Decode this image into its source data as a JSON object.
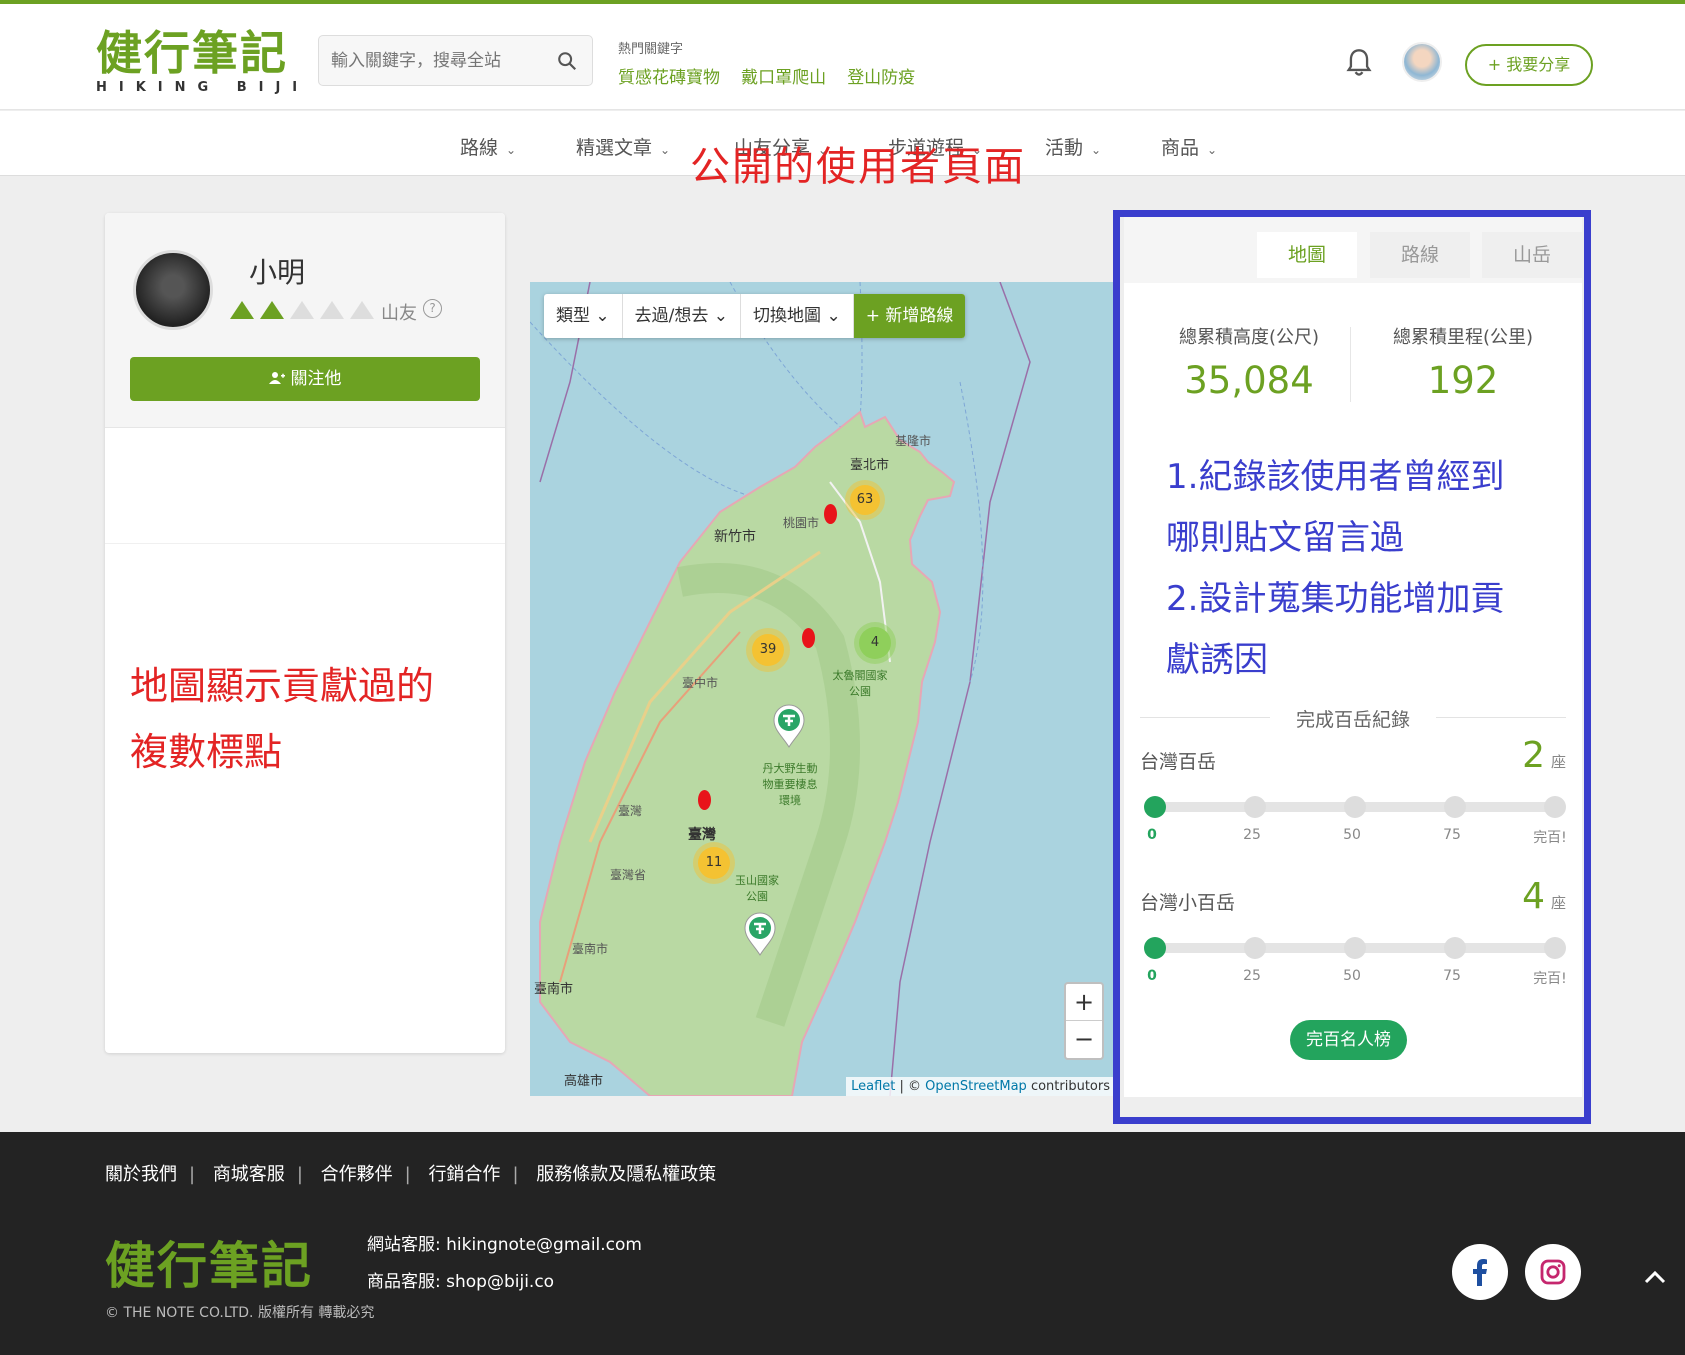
{
  "header": {
    "logo_main": "健行筆記",
    "logo_sub": "HIKING BIJI",
    "search_placeholder": "輸入關鍵字，搜尋全站",
    "hot_title": "熱門關鍵字",
    "hot_keywords": [
      "質感花磚寶物",
      "戴口罩爬山",
      "登山防疫"
    ],
    "share_label": "+ 我要分享"
  },
  "nav": {
    "items": [
      {
        "label": "路線"
      },
      {
        "label": "精選文章"
      },
      {
        "label": "山友分享"
      },
      {
        "label": "步道遊程"
      },
      {
        "label": "活動"
      },
      {
        "label": "商品"
      }
    ]
  },
  "annotations": {
    "title": "公開的使用者頁面",
    "left_line1": "地圖顯示貢獻過的",
    "left_line2": "複數標點",
    "right_line1": "1.紀錄該使用者曾經到",
    "right_line2": "哪則貼文留言過",
    "right_line3": "2.設計蒐集功能增加貢",
    "right_line4": "獻誘因"
  },
  "profile": {
    "name": "小明",
    "rank_label": "山友",
    "rank_level": 2,
    "rank_max": 5,
    "follow_label": "關注他"
  },
  "map": {
    "toolbar": {
      "type_label": "類型",
      "visited_label": "去過/想去",
      "switch_label": "切換地圖",
      "add_label": "+ 新增路線"
    },
    "clusters": [
      {
        "count": "63",
        "color": "#f4c232"
      },
      {
        "count": "39",
        "color": "#f4c232"
      },
      {
        "count": "4",
        "color": "#8fcf5b"
      },
      {
        "count": "11",
        "color": "#f4c232"
      }
    ],
    "place_labels": [
      "基隆市",
      "臺北市",
      "桃園市",
      "新竹市",
      "臺中市",
      "太魯閣國家公園",
      "丹大野生動物重要棲息環境",
      "臺灣",
      "臺灣",
      "臺灣省",
      "玉山國家公園",
      "臺南市",
      "臺南市",
      "高雄市"
    ],
    "zoom_in": "+",
    "zoom_out": "−",
    "attrib_leaflet": "Leaflet",
    "attrib_sep": " | © ",
    "attrib_osm": "OpenStreetMap",
    "attrib_tail": " contributors"
  },
  "tabs": [
    {
      "label": "地圖"
    },
    {
      "label": "路線"
    },
    {
      "label": "山岳"
    }
  ],
  "stats": {
    "elevation_label": "總累積高度(公尺)",
    "elevation_value": "35,084",
    "distance_label": "總累積里程(公里)",
    "distance_value": "192"
  },
  "records": {
    "title": "完成百岳紀錄",
    "ticks": [
      "0",
      "25",
      "50",
      "75",
      "完百!"
    ],
    "rows": [
      {
        "label": "台灣百岳",
        "count": "2",
        "unit": "座"
      },
      {
        "label": "台灣小百岳",
        "count": "4",
        "unit": "座"
      }
    ],
    "rank_button": "完百名人榜"
  },
  "footer": {
    "links": [
      "關於我們",
      "商城客服",
      "合作夥伴",
      "行銷合作",
      "服務條款及隱私權政策"
    ],
    "logo": "健行筆記",
    "site_service": "網站客服: hikingnote@gmail.com",
    "shop_service": "商品客服: shop@biji.co",
    "copyright": "© THE NOTE CO.LTD. 版權所有 轉載必究"
  },
  "colors": {
    "brand_green": "#6ca122",
    "accent_green": "#23a45d",
    "annotation_red": "#e32424",
    "annotation_blue": "#3a3ecd"
  }
}
